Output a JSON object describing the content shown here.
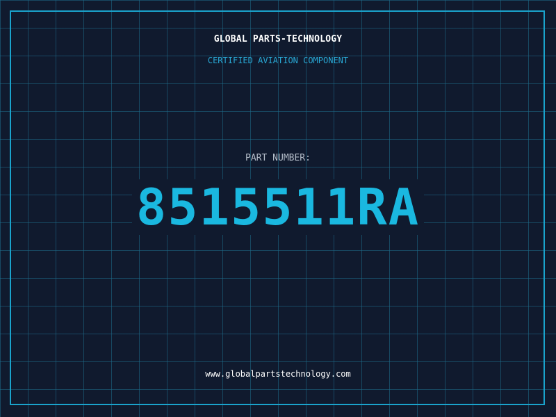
{
  "header": {
    "company_name": "GLOBAL PARTS-TECHNOLOGY",
    "subtitle": "CERTIFIED AVIATION COMPONENT"
  },
  "part": {
    "label": "PART NUMBER:",
    "number": "8515511RA"
  },
  "footer": {
    "website": "www.globalpartstechnology.com"
  },
  "colors": {
    "background": "#101a2e",
    "grid": "#1e6e8c",
    "accent": "#1ab8e0",
    "frame": "#1aa3cc",
    "label": "#b4bdc9",
    "text": "#ffffff"
  }
}
